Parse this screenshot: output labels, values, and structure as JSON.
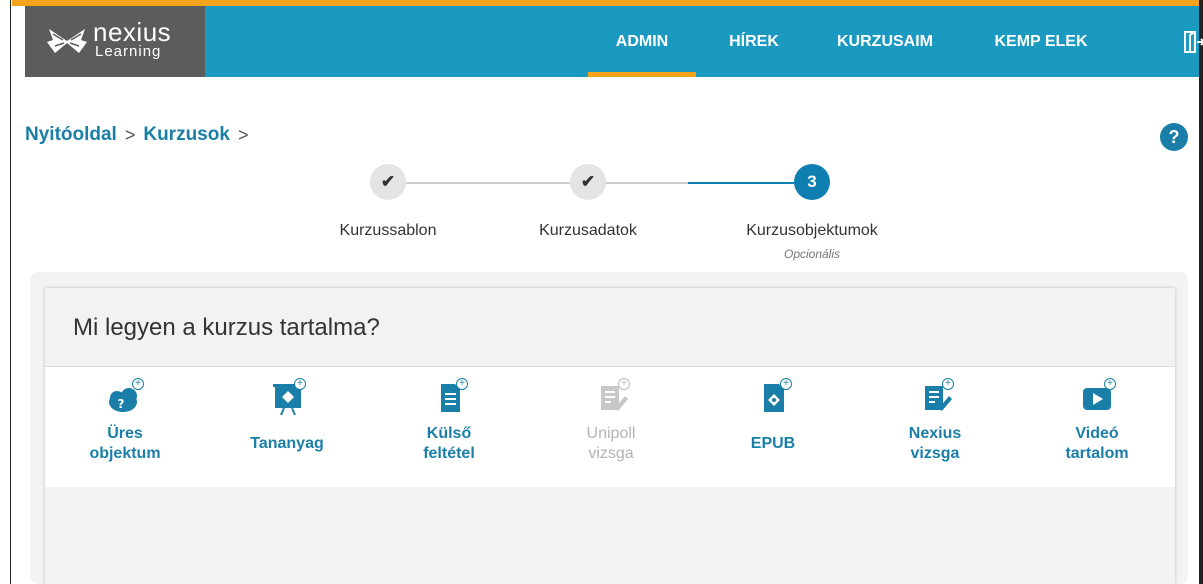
{
  "header": {
    "logo_word": "nexius",
    "logo_sub": "Learning",
    "nav": [
      "ADMIN",
      "HÍREK",
      "KURZUSAIM",
      "KEMP ELEK"
    ],
    "active_nav": "ADMIN",
    "logout_icon": "logout-icon"
  },
  "breadcrumb": [
    "Nyitóoldal",
    "Kurzusok"
  ],
  "help_label": "?",
  "stepper": {
    "steps": [
      {
        "label": "Kurzussablon",
        "state": "done",
        "mark": "✔"
      },
      {
        "label": "Kurzusadatok",
        "state": "done",
        "mark": "✔"
      },
      {
        "label": "Kurzusobjektumok",
        "state": "current",
        "mark": "3",
        "sub": "Opcionális"
      }
    ]
  },
  "card": {
    "title": "Mi legyen a kurzus tartalma?",
    "objects": [
      {
        "label_1": "Üres",
        "label_2": "objektum",
        "icon": "empty-object-icon",
        "enabled": true
      },
      {
        "label_1": "Tananyag",
        "label_2": "",
        "icon": "course-material-icon",
        "enabled": true
      },
      {
        "label_1": "Külső",
        "label_2": "feltétel",
        "icon": "external-condition-icon",
        "enabled": true
      },
      {
        "label_1": "Unipoll",
        "label_2": "vizsga",
        "icon": "unipoll-exam-icon",
        "enabled": false
      },
      {
        "label_1": "EPUB",
        "label_2": "",
        "icon": "epub-icon",
        "enabled": true
      },
      {
        "label_1": "Nexius",
        "label_2": "vizsga",
        "icon": "nexius-exam-icon",
        "enabled": true
      },
      {
        "label_1": "Videó",
        "label_2": "tartalom",
        "icon": "video-content-icon",
        "enabled": true
      }
    ]
  },
  "colors": {
    "header_bg": "#1a9ac0",
    "accent": "#f4a31c",
    "link": "#1a7fa8",
    "disabled": "#b4b4b4"
  }
}
